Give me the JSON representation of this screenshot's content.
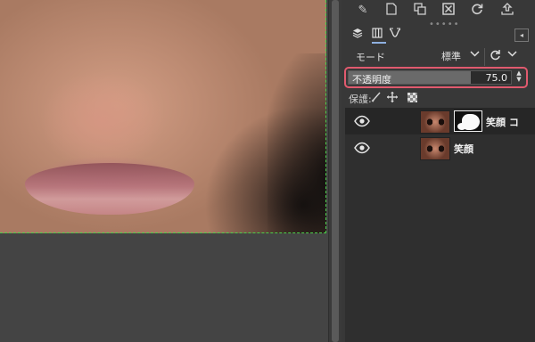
{
  "toolbar": {
    "buttons": [
      {
        "name": "edit-layer-attributes-icon",
        "glyph": "✎"
      },
      {
        "name": "new-layer-icon",
        "glyph": "🗋"
      },
      {
        "name": "duplicate-layer-icon",
        "glyph": "⧉"
      },
      {
        "name": "delete-layer-icon",
        "glyph": "⊠"
      },
      {
        "name": "refresh-icon",
        "glyph": "↻"
      },
      {
        "name": "export-icon",
        "glyph": "⇪"
      }
    ]
  },
  "layers_panel": {
    "mode_label": "モード",
    "mode_value": "標準",
    "opacity_label": "不透明度",
    "opacity_value": "75.0",
    "opacity_fraction": 0.75,
    "lock_label": "保護:"
  },
  "layers": [
    {
      "name": "笑顔 コ",
      "has_mask": true,
      "visible": true
    },
    {
      "name": "笑顔",
      "has_mask": false,
      "visible": true
    }
  ],
  "colors": {
    "highlight": "#e15a6e",
    "selection": "#4ad04a"
  }
}
